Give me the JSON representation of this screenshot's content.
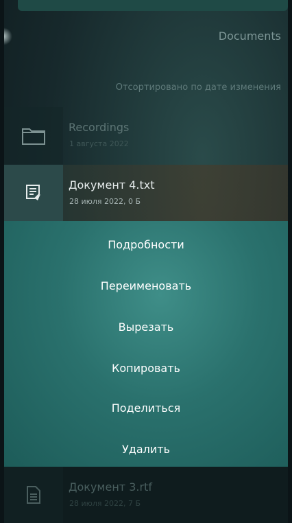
{
  "header": {
    "title": "Documents",
    "sort_label": "Отсортировано по дате изменения"
  },
  "files": [
    {
      "name": "Recordings",
      "meta": "1 августа 2022",
      "icon": "folder-icon"
    },
    {
      "name": "Документ 4.txt",
      "meta": "28 июля 2022, 0 Б",
      "icon": "text-file-icon"
    },
    {
      "name": "Документ 3.rtf",
      "meta": "28 июля 2022, 7 Б",
      "icon": "document-icon"
    }
  ],
  "context_menu": {
    "items": [
      "Подробности",
      "Переименовать",
      "Вырезать",
      "Копировать",
      "Поделиться",
      "Удалить"
    ]
  },
  "colors": {
    "menu_bg": "#2a716d",
    "background": "#17292c",
    "text_light": "#ffffff"
  }
}
